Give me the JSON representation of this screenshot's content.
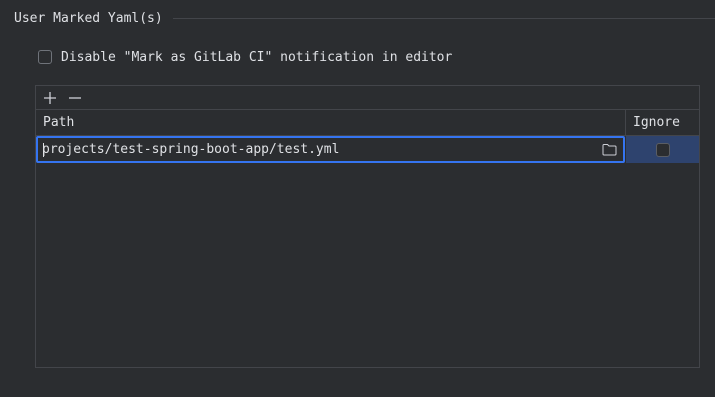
{
  "section": {
    "title": "User Marked Yaml(s)"
  },
  "notification_option": {
    "label": "Disable \"Mark as GitLab CI\" notification in editor",
    "checked": false
  },
  "toolbar": {
    "add_icon": "plus-icon",
    "remove_icon": "minus-icon"
  },
  "table": {
    "columns": [
      "Path",
      "Ignore"
    ],
    "rows": [
      {
        "path": "projects/test-spring-boot-app/test.yml",
        "ignore": false,
        "browse_icon": "folder-icon"
      }
    ]
  },
  "colors": {
    "background": "#2b2d30",
    "text": "#dfe1e5",
    "focus_border": "#3574f0",
    "selection": "#2e436e"
  }
}
